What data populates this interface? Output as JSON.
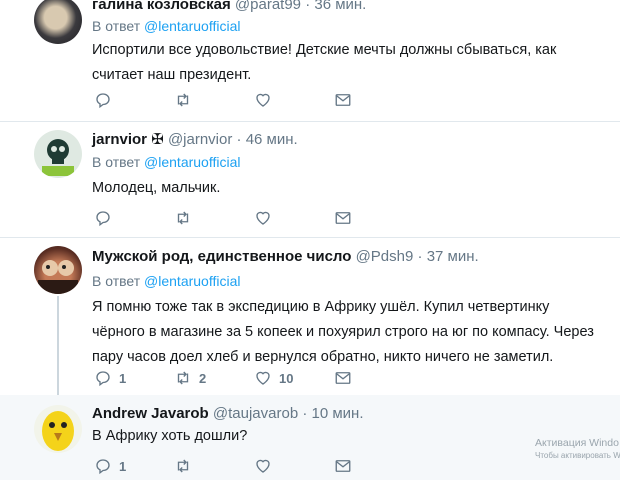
{
  "replying_to_label": "В ответ",
  "tweets": [
    {
      "name": "галина козловская",
      "handle": "@parat99",
      "time": "36 мин.",
      "reply_to": "@lentaruofficial",
      "text": "Испортили все удовольствие! Детские мечты должны сбываться, как считает наш президент.",
      "replies": "",
      "retweets": "",
      "likes": ""
    },
    {
      "name": "jarnvior ✠",
      "handle": "@jarnvior",
      "time": "46 мин.",
      "reply_to": "@lentaruofficial",
      "text": "Молодец, мальчик.",
      "replies": "",
      "retweets": "",
      "likes": ""
    },
    {
      "name": "Мужской род, единственное число",
      "handle": "@Pdsh9",
      "time": "37 мин.",
      "reply_to": "@lentaruofficial",
      "text": "Я помню тоже так в экспедицию в Африку ушёл. Купил четвертинку чёрного в магазине за 5 копеек и похуярил строго на юг по компасу. Через пару часов доел хлеб и вернулся обратно, никто ничего не заметил.",
      "replies": "1",
      "retweets": "2",
      "likes": "10"
    },
    {
      "name": "Andrew Javarob",
      "handle": "@taujavarob",
      "time": "10 мин.",
      "reply_to": "",
      "text": "В Африку хоть дошли?",
      "replies": "1",
      "retweets": "",
      "likes": ""
    }
  ],
  "watermark": {
    "line1": "Активация Windo",
    "line2": "Чтобы активировать Windows"
  }
}
